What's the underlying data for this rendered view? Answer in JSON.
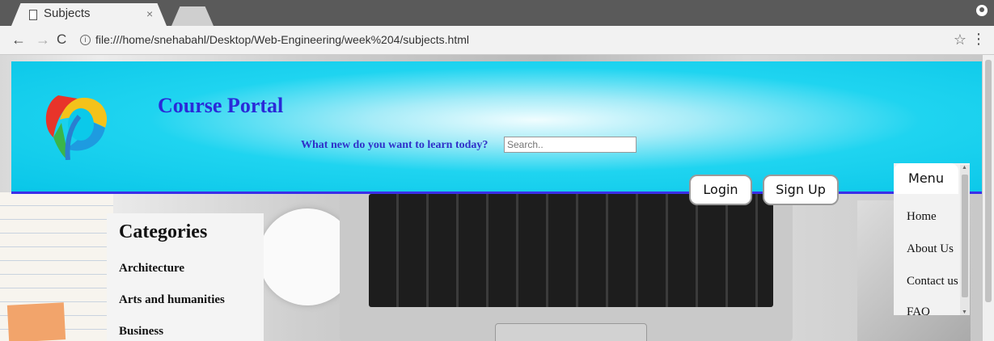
{
  "browser": {
    "tab_title": "Subjects",
    "tab_close": "×",
    "url": "file:///home/snehabahl/Desktop/Web-Engineering/week%204/subjects.html",
    "back_glyph": "←",
    "forward_glyph": "→",
    "reload_glyph": "C",
    "info_glyph": "i",
    "star_glyph": "☆",
    "menu_glyph": "⋮"
  },
  "header": {
    "title": "Course Portal",
    "search_label": "What new do you want to learn today?",
    "search_placeholder": "Search..",
    "login_label": "Login",
    "signup_label": "Sign Up"
  },
  "categories": {
    "title": "Categories",
    "items": [
      "Architecture",
      "Arts and humanities",
      "Business"
    ]
  },
  "menu": {
    "label": "Menu",
    "items": [
      "Home",
      "About Us",
      "Contact us",
      "FAQ"
    ]
  },
  "colors": {
    "title": "#2a2ad8",
    "header_bg": "#09c6e8",
    "header_border": "#3b2fe8"
  },
  "icons": {
    "tab": "page-icon",
    "logo": "course-portal-logo",
    "profile": "profile-icon"
  }
}
